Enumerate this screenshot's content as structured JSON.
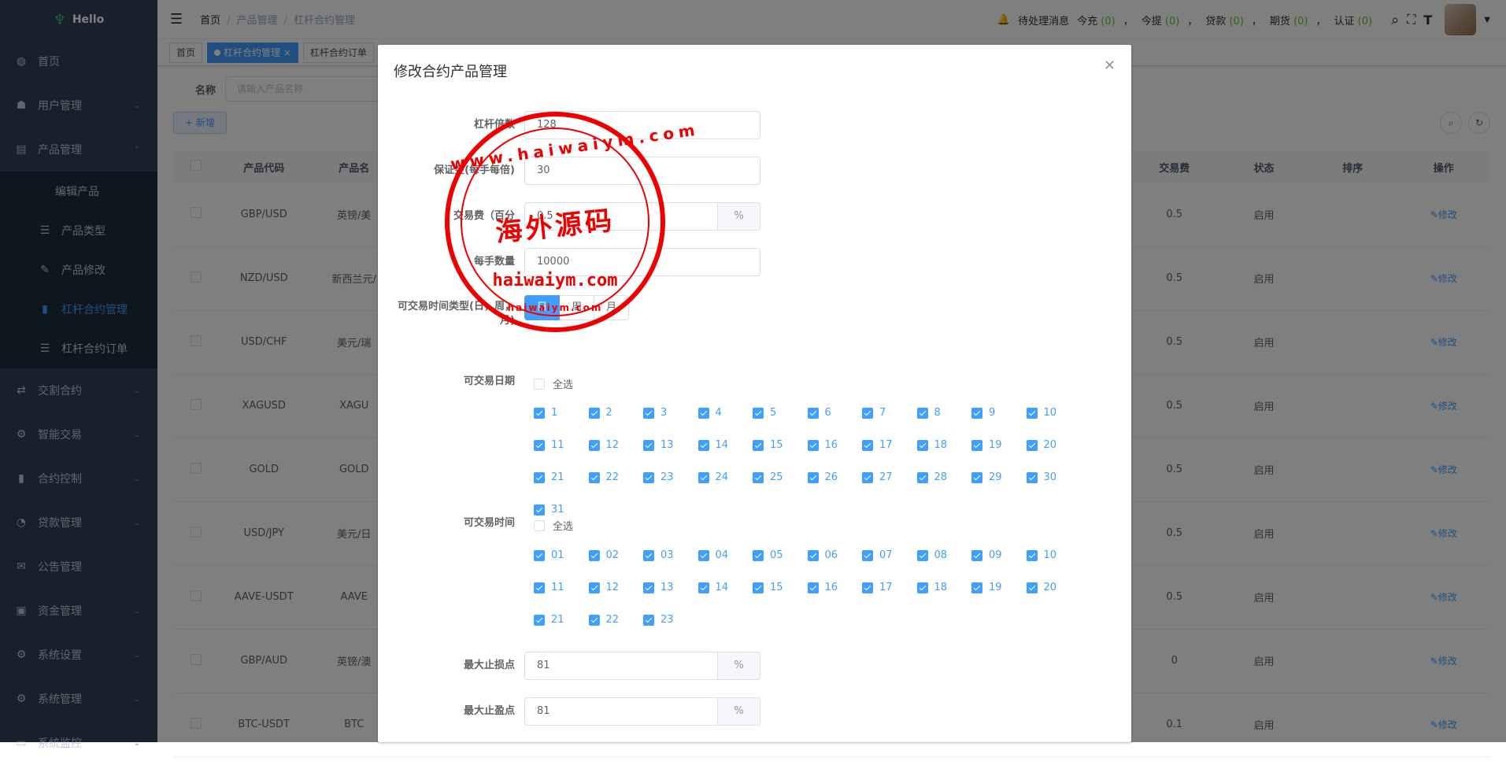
{
  "app": {
    "logo_text": "Hello"
  },
  "sidebar": {
    "items": [
      {
        "label": "首页",
        "icon": "dashboard-icon"
      },
      {
        "label": "用户管理",
        "icon": "user-icon"
      },
      {
        "label": "产品管理",
        "icon": "document-icon"
      },
      {
        "label": "交割合约",
        "icon": "trade-icon"
      },
      {
        "label": "智能交易",
        "icon": "gear-icon"
      },
      {
        "label": "合约控制",
        "icon": "chart-icon"
      },
      {
        "label": "贷款管理",
        "icon": "loan-icon"
      },
      {
        "label": "公告管理",
        "icon": "message-icon"
      },
      {
        "label": "资金管理",
        "icon": "money-icon"
      },
      {
        "label": "系统设置",
        "icon": "settings-icon"
      },
      {
        "label": "系统管理",
        "icon": "settings-icon"
      },
      {
        "label": "系统监控",
        "icon": "monitor-icon"
      }
    ],
    "sub_items": [
      {
        "label": "编辑产品"
      },
      {
        "label": "产品类型"
      },
      {
        "label": "产品修改"
      },
      {
        "label": "杠杆合约管理"
      },
      {
        "label": "杠杆合约订单"
      }
    ]
  },
  "navbar": {
    "breadcrumb": [
      "首页",
      "产品管理",
      "杠杆合约管理"
    ],
    "pending_label": "待处理消息",
    "stats": [
      {
        "label": "今充",
        "value": "(0)"
      },
      {
        "label": "今提",
        "value": "(0)"
      },
      {
        "label": "贷款",
        "value": "(0)"
      },
      {
        "label": "期货",
        "value": "(0)"
      },
      {
        "label": "认证",
        "value": "(0)"
      }
    ],
    "sep": "，"
  },
  "tags": [
    "首页",
    "杠杆合约管理",
    "杠杆合约订单"
  ],
  "search": {
    "label": "名称",
    "placeholder": "请输入产品名称",
    "add_label": "+ 新增"
  },
  "table": {
    "headers": [
      "产品代码",
      "产品名",
      "交易费",
      "状态",
      "排序",
      "操作"
    ],
    "edit_label": "修改",
    "rows": [
      {
        "code": "GBP/USD",
        "name": "英镑/美",
        "fee": "0.5",
        "status": "启用"
      },
      {
        "code": "NZD/USD",
        "name": "新西兰元/",
        "fee": "0.5",
        "status": "启用"
      },
      {
        "code": "USD/CHF",
        "name": "美元/瑞",
        "fee": "0.5",
        "status": "启用"
      },
      {
        "code": "XAGUSD",
        "name": "XAGU",
        "fee": "0.5",
        "status": "启用"
      },
      {
        "code": "GOLD",
        "name": "GOLD",
        "fee": "0.5",
        "status": "启用"
      },
      {
        "code": "USD/JPY",
        "name": "美元/日",
        "fee": "0.5",
        "status": "启用"
      },
      {
        "code": "AAVE-USDT",
        "name": "AAVE",
        "fee": "0.5",
        "status": "启用"
      },
      {
        "code": "GBP/AUD",
        "name": "英镑/澳",
        "fee": "0",
        "status": "启用"
      },
      {
        "code": "BTC-USDT",
        "name": "BTC",
        "fee": "0.1",
        "status": "启用"
      }
    ]
  },
  "dialog": {
    "title": "修改合约产品管理",
    "fields": {
      "leverage": {
        "label": "杠杆倍数",
        "value": "128"
      },
      "margin": {
        "label": "保证金(每手每倍)",
        "value": "30"
      },
      "fee": {
        "label": "交易费（百分",
        "value": "0.5",
        "unit": "%"
      },
      "lot": {
        "label": "每手数量",
        "value": "10000"
      },
      "time_type": {
        "label_1": "可交易时间类型(日，周，",
        "label_2": "月)",
        "options": [
          "日",
          "周",
          "月"
        ],
        "selected": "日"
      },
      "trade_days": {
        "label": "可交易日期",
        "select_all": "全选"
      },
      "trade_hours": {
        "label": "可交易时间",
        "select_all": "全选"
      },
      "max_stop_loss": {
        "label": "最大止损点",
        "value": "81",
        "unit": "%"
      },
      "max_take_profit": {
        "label": "最大止盈点",
        "value": "81",
        "unit": "%"
      }
    },
    "days": [
      "1",
      "2",
      "3",
      "4",
      "5",
      "6",
      "7",
      "8",
      "9",
      "10",
      "11",
      "12",
      "13",
      "14",
      "15",
      "16",
      "17",
      "18",
      "19",
      "20",
      "21",
      "22",
      "23",
      "24",
      "25",
      "26",
      "27",
      "28",
      "29",
      "30",
      "31"
    ],
    "hours": [
      "01",
      "02",
      "03",
      "04",
      "05",
      "06",
      "07",
      "08",
      "09",
      "10",
      "11",
      "12",
      "13",
      "14",
      "15",
      "16",
      "17",
      "18",
      "19",
      "20",
      "21",
      "22",
      "23"
    ]
  },
  "watermark": {
    "outer": "www.haiwaiym.com",
    "center": "海外源码",
    "domain": "haiwaiym.com",
    "bottom": "haiwaiym.com"
  }
}
